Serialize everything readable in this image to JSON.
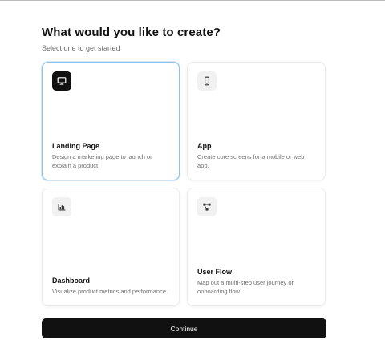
{
  "header": {
    "title": "What would you like to create?",
    "subtitle": "Select one to get started"
  },
  "options": [
    {
      "title": "Landing Page",
      "description": "Design a marketing page to launch or explain a product.",
      "icon": "monitor-icon",
      "selected": true
    },
    {
      "title": "App",
      "description": "Create core screens for a mobile or web app.",
      "icon": "smartphone-icon",
      "selected": false
    },
    {
      "title": "Dashboard",
      "description": "Visualize product metrics and performance.",
      "icon": "bar-chart-icon",
      "selected": false
    },
    {
      "title": "User Flow",
      "description": "Map out a multi-step user journey or onboarding flow.",
      "icon": "flow-nodes-icon",
      "selected": false
    }
  ],
  "continue_label": "Continue",
  "colors": {
    "selected_border": "#8fc2e6",
    "primary_button": "#111111"
  }
}
